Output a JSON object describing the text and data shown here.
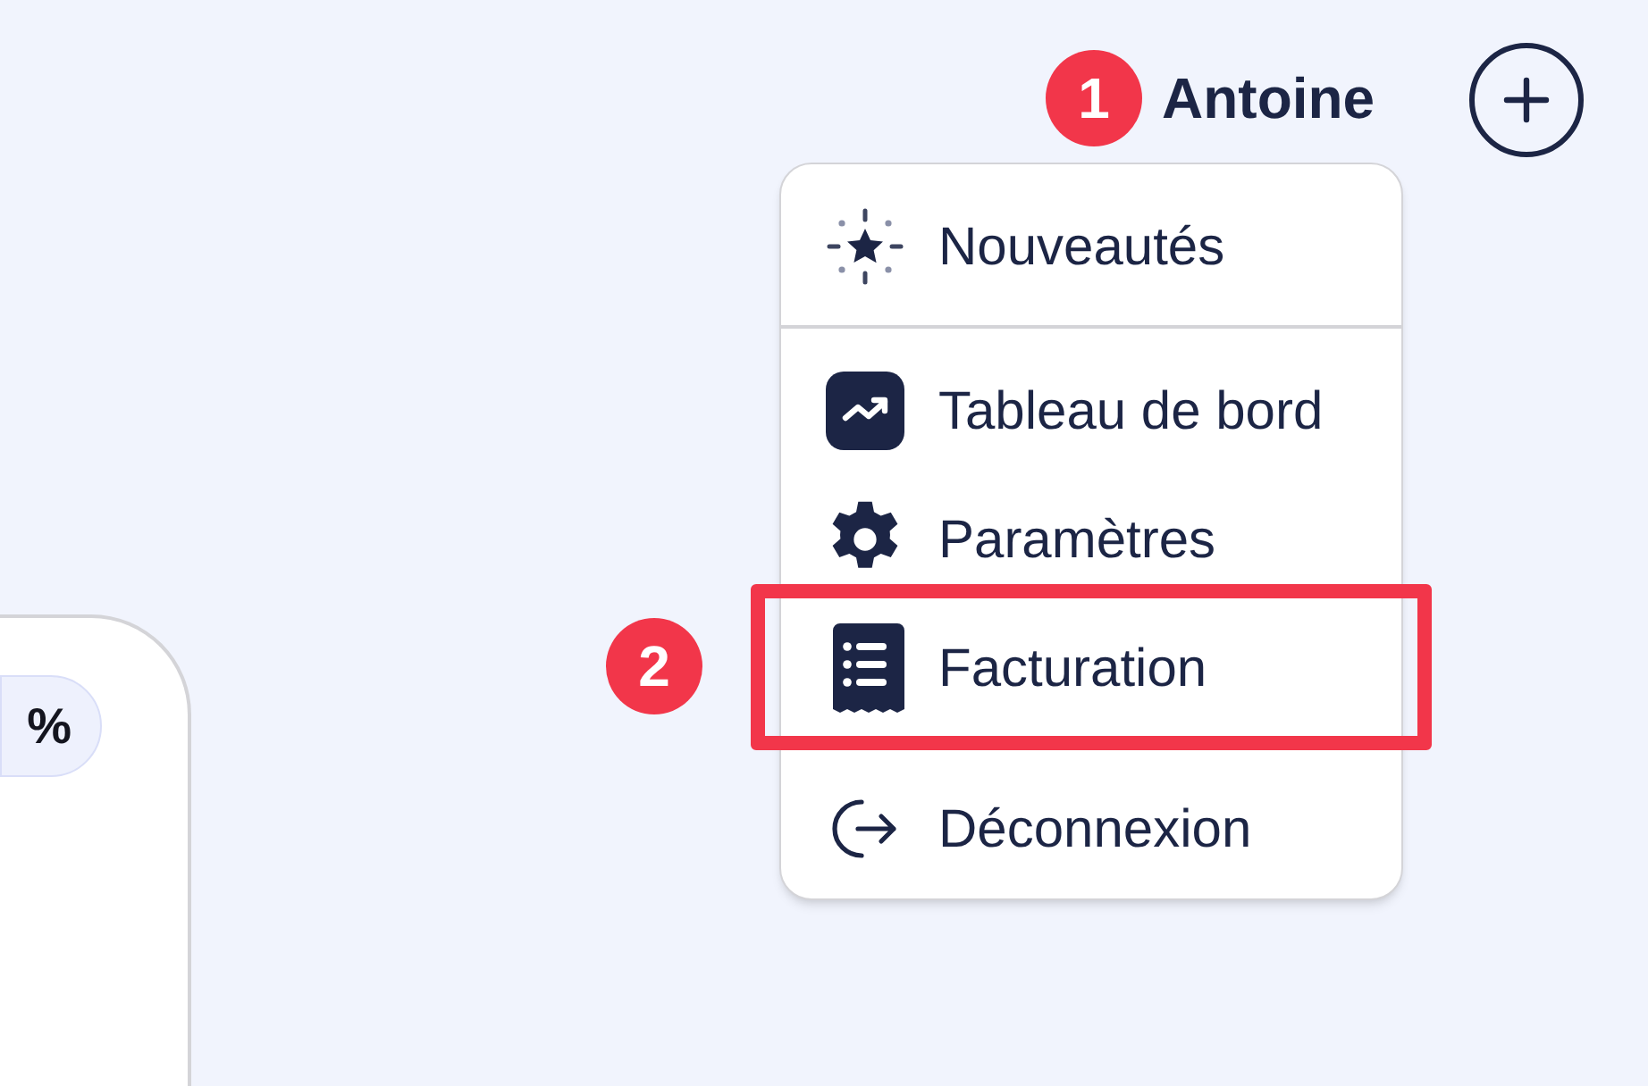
{
  "header": {
    "user_name": "Antoine",
    "user_marker": "1"
  },
  "menu": {
    "sections": [
      {
        "items": [
          {
            "label": "Nouveautés",
            "kind": "news",
            "highlighted": false
          }
        ]
      },
      {
        "items": [
          {
            "label": "Tableau de bord",
            "kind": "dashboard",
            "highlighted": false
          },
          {
            "label": "Paramètres",
            "kind": "settings",
            "highlighted": false
          },
          {
            "label": "Facturation",
            "kind": "billing",
            "highlighted": true,
            "marker": "2"
          },
          {
            "label": "Déconnexion",
            "kind": "logout",
            "highlighted": false
          }
        ]
      }
    ]
  },
  "card": {
    "pill_text": "%"
  }
}
